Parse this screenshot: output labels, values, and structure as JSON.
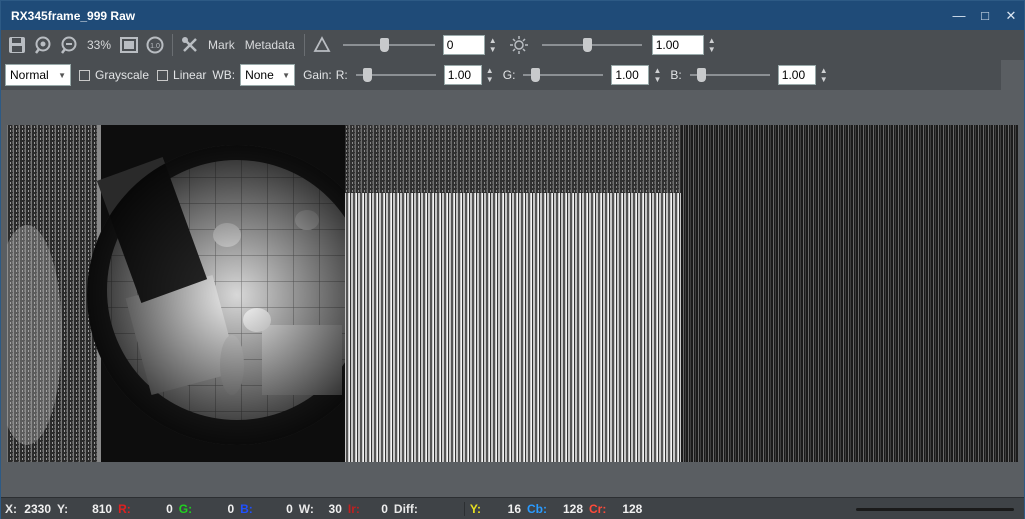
{
  "window": {
    "title": "RX345frame_999 Raw",
    "minimize_glyph": "—",
    "maximize_glyph": "□",
    "close_glyph": "✕"
  },
  "toolbar": {
    "zoom_label": "33%",
    "mark_label": "Mark",
    "metadata_label": "Metadata",
    "exposure_value": "0",
    "exposure_level": 0.45,
    "brightness_value": "1.00",
    "brightness_level": 0.45
  },
  "toolbar2": {
    "mode_value": "Normal",
    "grayscale_label": "Grayscale",
    "linear_label": "Linear",
    "wb_label": "WB:",
    "wb_value": "None",
    "gain_label": "Gain:",
    "r_label": "R:",
    "r_value": "1.00",
    "g_label": "G:",
    "g_value": "1.00",
    "b_label": "B:",
    "b_value": "1.00",
    "gain_level": 0.1
  },
  "status": {
    "x_label": "X:",
    "x_value": "2330",
    "y_label": "Y:",
    "y_value": "810",
    "r_label": "R:",
    "r_value": "0",
    "g_label": "G:",
    "g_value": "0",
    "b_label": "B:",
    "b_value": "0",
    "w_label": "W:",
    "w_value": "30",
    "ir_label": "Ir:",
    "ir_value": "0",
    "diff_label": "Diff:",
    "yy_label": "Y:",
    "yy_value": "16",
    "cb_label": "Cb:",
    "cb_value": "128",
    "cr_label": "Cr:",
    "cr_value": "128"
  },
  "colors": {
    "title_bg": "#1f4b78",
    "toolbar_bg": "#4a4e52",
    "r": "#e02020",
    "g": "#20d020",
    "b": "#2050ff",
    "ir": "#c02020",
    "y": "#e8e020",
    "cb": "#2a9bff",
    "cr": "#ff4a3a"
  }
}
